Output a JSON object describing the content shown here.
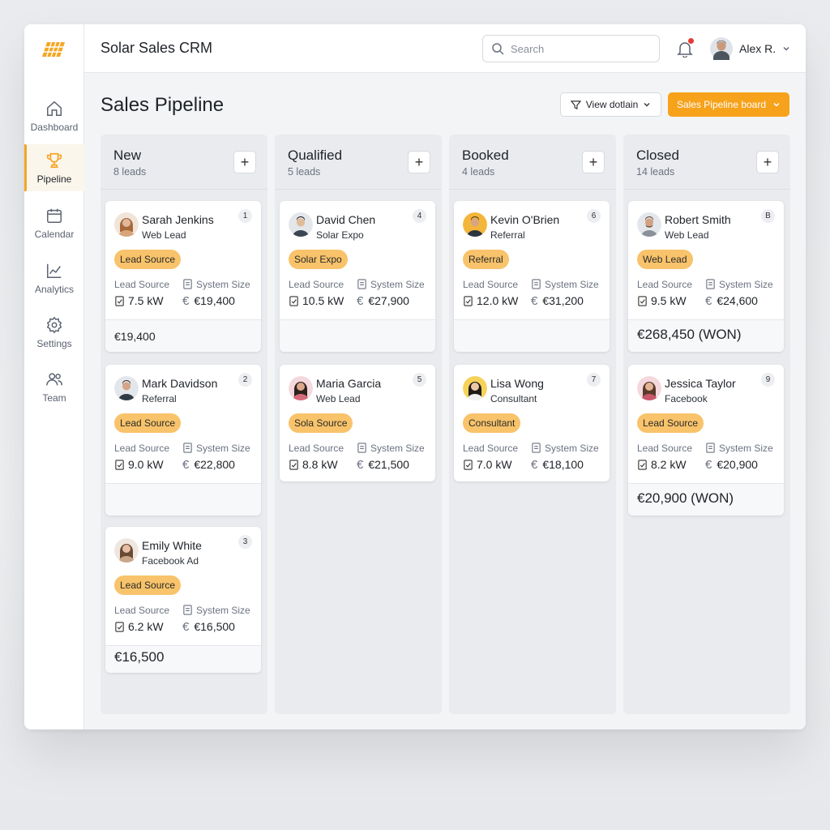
{
  "app": {
    "title": "Solar Sales CRM",
    "accent": "#f5a623"
  },
  "sidebar": {
    "items": [
      {
        "label": "Dashboard",
        "icon": "home-icon"
      },
      {
        "label": "Pipeline",
        "icon": "trophy-icon",
        "active": true
      },
      {
        "label": "Calendar",
        "icon": "calendar-icon"
      },
      {
        "label": "Analytics",
        "icon": "chart-icon"
      },
      {
        "label": "Settings",
        "icon": "gear-icon"
      },
      {
        "label": "Team",
        "icon": "team-icon"
      }
    ]
  },
  "header": {
    "search_placeholder": "Search",
    "user_name": "Alex R.",
    "notification_dot_color": "#e53935"
  },
  "page": {
    "title": "Sales Pipeline",
    "view_button": "View dotlain",
    "board_button": "Sales Pipeline board"
  },
  "columns": [
    {
      "title": "New",
      "count": "8 leads",
      "cards": [
        {
          "name": "Sarah Jenkins",
          "source": "Web Lead",
          "num": "1",
          "badge": "Lead Source",
          "k1": "Lead Source",
          "k2": "System Size",
          "size": "7.5 kW",
          "value": "€19,400",
          "footer": "€19,400"
        },
        {
          "name": "Mark Davidson",
          "source": "Referral",
          "num": "2",
          "badge": "Lead Source",
          "k1": "Lead Source",
          "k2": "System Size",
          "size": "9.0 kW",
          "value": "€22,800",
          "footer": ""
        },
        {
          "name": "Emily White",
          "source": "Facebook Ad",
          "num": "3",
          "badge": "Lead Source",
          "k1": "Lead Source",
          "k2": "System Size",
          "size": "6.2 kW",
          "value": "€16,500",
          "footer": "€16,500"
        }
      ]
    },
    {
      "title": "Qualified",
      "count": "5 leads",
      "cards": [
        {
          "name": "David Chen",
          "source": "Solar Expo",
          "num": "4",
          "badge": "Solar Expo",
          "k1": "Lead Source",
          "k2": "System Size",
          "size": "10.5 kW",
          "value": "€27,900",
          "footer": ""
        },
        {
          "name": "Maria Garcia",
          "source": "Web Lead",
          "num": "5",
          "badge": "Sola Source",
          "k1": "Lead Source",
          "k2": "System Size",
          "size": "8.8 kW",
          "value": "€21,500"
        }
      ]
    },
    {
      "title": "Booked",
      "count": "4 leads",
      "cards": [
        {
          "name": "Kevin O'Brien",
          "source": "Referral",
          "num": "6",
          "badge": "Referral",
          "k1": "Lead Source",
          "k2": "System Size",
          "size": "12.0 kW",
          "value": "€31,200",
          "footer": ""
        },
        {
          "name": "Lisa Wong",
          "source": "Consultant",
          "num": "7",
          "badge": "Consultant",
          "k1": "Lead Source",
          "k2": "System Size",
          "size": "7.0 kW",
          "value": "€18,100"
        }
      ]
    },
    {
      "title": "Closed",
      "count": "14 leads",
      "cards": [
        {
          "name": "Robert Smith",
          "source": "Web Lead",
          "num": "B",
          "badge": "Web Lead",
          "k1": "Lead Source",
          "k2": "System Size",
          "size": "9.5 kW",
          "value": "€24,600",
          "footer": "€268,450 (WON)"
        },
        {
          "name": "Jessica Taylor",
          "source": "Facebook",
          "num": "9",
          "badge": "Lead Source",
          "k1": "Lead Source",
          "k2": "System Size",
          "size": "8.2 kW",
          "value": "€20,900",
          "footer": "€20,900 (WON)"
        }
      ]
    }
  ]
}
